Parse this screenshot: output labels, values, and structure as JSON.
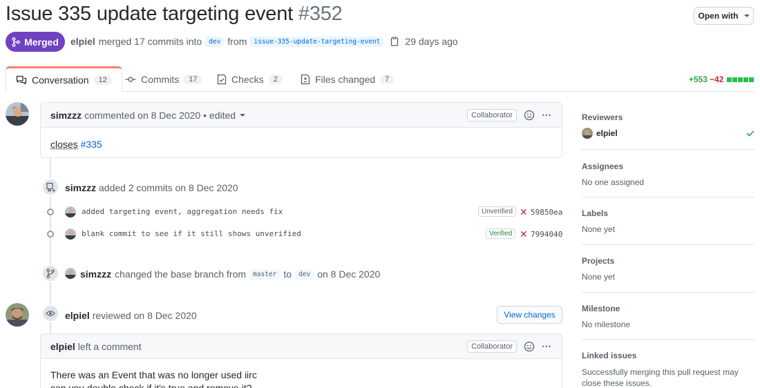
{
  "header": {
    "title": "Issue 335 update targeting event",
    "number": "#352",
    "open_with": "Open with",
    "state": "Merged",
    "author": "elpiel",
    "merged_text": "merged 17 commits into",
    "base_branch": "dev",
    "from_text": "from",
    "head_branch": "issue-335-update-targeting-event",
    "time_ago": "29 days ago"
  },
  "tabs": [
    {
      "label": "Conversation",
      "count": "12",
      "icon": "comment-discussion-icon"
    },
    {
      "label": "Commits",
      "count": "17",
      "icon": "git-commit-icon"
    },
    {
      "label": "Checks",
      "count": "2",
      "icon": "checklist-icon"
    },
    {
      "label": "Files changed",
      "count": "7",
      "icon": "file-diff-icon"
    }
  ],
  "diffstat": {
    "additions": "+553",
    "deletions": "−42"
  },
  "timeline": {
    "first_comment": {
      "author": "simzzz",
      "meta": "commented on 8 Dec 2020 • edited",
      "role": "Collaborator",
      "body_text": "closes",
      "body_link": "#335"
    },
    "commits_event": {
      "author": "simzzz",
      "text": "added 2 commits on 8 Dec 2020",
      "commits": [
        {
          "message": "added targeting event, aggregation needs fix",
          "status": "Unverified",
          "sha": "59850ea"
        },
        {
          "message": "blank commit to see if it still shows unverified",
          "status": "Verified",
          "sha": "7994040"
        }
      ]
    },
    "branch_event": {
      "author": "simzzz",
      "text": "changed the base branch from",
      "from": "master",
      "to_text": "to",
      "to": "dev",
      "date": "on 8 Dec 2020"
    },
    "review_event": {
      "author": "elpiel",
      "text": "reviewed on 8 Dec 2020",
      "button": "View changes"
    },
    "review_comment": {
      "author": "elpiel",
      "meta": "left a comment",
      "role": "Collaborator",
      "line1": "There was an Event that was no longer used iirc",
      "line2": "can you double check if it's true and remove it?"
    }
  },
  "sidebar": {
    "reviewers": {
      "heading": "Reviewers",
      "name": "elpiel"
    },
    "assignees": {
      "heading": "Assignees",
      "value": "No one assigned"
    },
    "labels": {
      "heading": "Labels",
      "value": "None yet"
    },
    "projects": {
      "heading": "Projects",
      "value": "None yet"
    },
    "milestone": {
      "heading": "Milestone",
      "value": "No milestone"
    },
    "linked": {
      "heading": "Linked issues",
      "value": "Successfully merging this pull request may close these issues."
    }
  },
  "colors": {
    "merged": "#6f42c1",
    "link": "#0366d6",
    "added": "#28a745",
    "deleted": "#cb2431",
    "tab_accent": "#f9826c"
  }
}
